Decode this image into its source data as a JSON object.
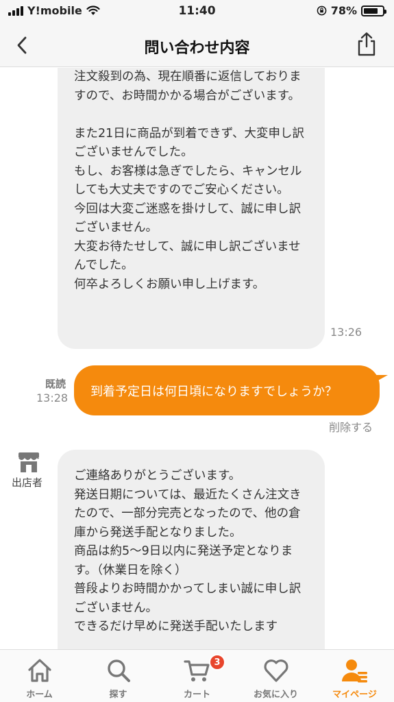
{
  "status_bar": {
    "carrier": "Y!mobile",
    "time": "11:40",
    "battery": "78%",
    "battery_level": 0.78
  },
  "header": {
    "title": "問い合わせ内容"
  },
  "messages": [
    {
      "sender": "shop",
      "text": "注文殺到の為、現在順番に返信しておりますので、お時間かかる場合がございます。\n\nまた21日に商品が到着できず、大変申し訳ございませんでした。\nもし、お客様は急ぎでしたら、キャンセルしても大丈夫ですのでご安心ください。\n今回は大変ご迷惑を掛けして、誠に申し訳ございません。\n大変お待たせして、誠に申し訳ございませんでした。\n何卒よろしくお願い申し上げます。",
      "time": "13:26"
    },
    {
      "sender": "me",
      "read_label": "既読",
      "time": "13:28",
      "text": "到着予定日は何日頃になりますでしょうか？",
      "delete_label": "削除する"
    },
    {
      "sender": "shop",
      "sender_label": "出店者",
      "text": "ご連絡ありがとうございます。\n発送日期については、最近たくさん注文きたので、一部分完売となったので、他の倉庫から発送手配となりました。\n商品は約5～9日以内に発送予定となります。（休業日を除く）\n普段よりお時間かかってしまい誠に申し訳ございません。\nできるだけ早めに発送手配いたします"
    }
  ],
  "tabs": [
    {
      "label": "ホーム",
      "icon": "home-icon"
    },
    {
      "label": "探す",
      "icon": "search-icon"
    },
    {
      "label": "カート",
      "icon": "cart-icon",
      "badge": "3"
    },
    {
      "label": "お気に入り",
      "icon": "heart-icon"
    },
    {
      "label": "マイページ",
      "icon": "mypage-icon",
      "active": true
    }
  ],
  "colors": {
    "accent": "#f58a0d",
    "badge": "#e8452c",
    "bubble_in": "#efefef"
  }
}
